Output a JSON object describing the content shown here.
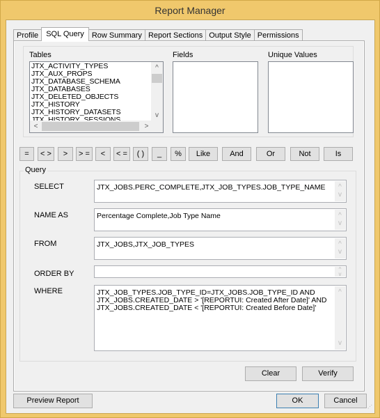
{
  "window": {
    "title": "Report Manager"
  },
  "tabs": [
    {
      "label": "Profile",
      "active": false
    },
    {
      "label": "SQL Query",
      "active": true
    },
    {
      "label": "Row Summary",
      "active": false
    },
    {
      "label": "Report Sections",
      "active": false
    },
    {
      "label": "Output Style",
      "active": false
    },
    {
      "label": "Permissions",
      "active": false
    }
  ],
  "tables": {
    "label": "Tables",
    "items": [
      "JTX_ACTIVITY_TYPES",
      "JTX_AUX_PROPS",
      "JTX_DATABASE_SCHEMA",
      "JTX_DATABASES",
      "JTX_DELETED_OBJECTS",
      "JTX_HISTORY",
      "JTX_HISTORY_DATASETS",
      "JTX_HISTORY_SESSIONS"
    ]
  },
  "fields": {
    "label": "Fields",
    "items": []
  },
  "unique_values": {
    "label": "Unique Values",
    "items": []
  },
  "operators": [
    "=",
    "< >",
    ">",
    "> =",
    "<",
    "< =",
    "( )",
    "_",
    "%",
    "Like",
    "And",
    "Or",
    "Not",
    "Is"
  ],
  "query": {
    "group_label": "Query",
    "select_label": "SELECT",
    "select_value": "JTX_JOBS.PERC_COMPLETE,JTX_JOB_TYPES.JOB_TYPE_NAME",
    "name_as_label": "NAME AS",
    "name_as_value": "Percentage Complete,Job Type Name",
    "from_label": "FROM",
    "from_value": "JTX_JOBS,JTX_JOB_TYPES",
    "order_by_label": "ORDER BY",
    "order_by_value": "",
    "where_label": "WHERE",
    "where_value": "JTX_JOB_TYPES.JOB_TYPE_ID=JTX_JOBS.JOB_TYPE_ID AND\nJTX_JOBS.CREATED_DATE > '[REPORTUI: Created After Date]' AND\nJTX_JOBS.CREATED_DATE < '[REPORTUI: Created Before Date]'"
  },
  "buttons": {
    "clear": "Clear",
    "verify": "Verify",
    "preview_report": "Preview Report",
    "ok": "OK",
    "cancel": "Cancel"
  },
  "icons": {
    "scroll_up": "▲",
    "scroll_down": "▼",
    "scroll_left": "<",
    "scroll_right": ">",
    "chevron_up": "^",
    "chevron_down": "v"
  }
}
